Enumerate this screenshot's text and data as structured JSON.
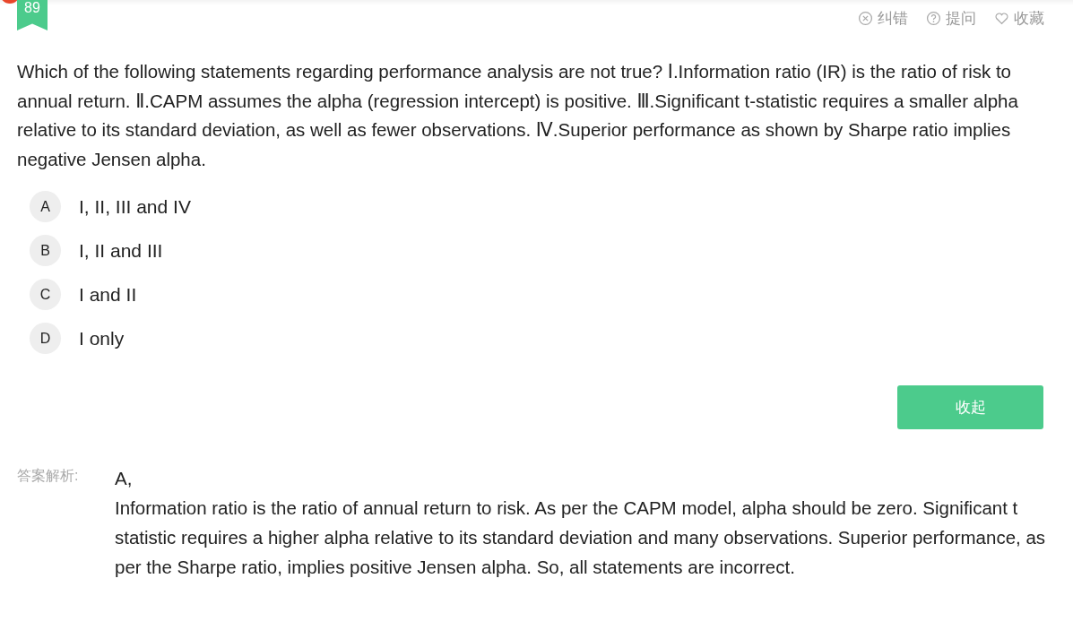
{
  "question": {
    "number": "89",
    "actions": [
      {
        "kind": "report",
        "label": "纠错"
      },
      {
        "kind": "ask",
        "label": "提问"
      },
      {
        "kind": "favorite",
        "label": "收藏"
      }
    ],
    "text": "Which of the following statements regarding performance analysis are not true? Ⅰ.Information ratio (IR) is the ratio of risk to annual return.  Ⅱ.CAPM assumes the alpha (regression intercept) is positive. Ⅲ.Significant t-statistic requires a smaller alpha relative to its standard deviation, as well as fewer observations.  Ⅳ.Superior performance as shown by Sharpe ratio implies negative Jensen alpha.",
    "options": [
      {
        "letter": "A",
        "text": "I, II, III and IV"
      },
      {
        "letter": "B",
        "text": "I, II and III"
      },
      {
        "letter": "C",
        "text": "I and II"
      },
      {
        "letter": "D",
        "text": "I only"
      }
    ],
    "collapse_button": "收起"
  },
  "analysis": {
    "label": "答案解析:",
    "answer": "A,",
    "explanation": "Information ratio is the ratio of annual return to risk. As per the CAPM model, alpha should be zero. Significant t statistic requires a higher alpha relative to its standard deviation and many observations. Superior performance, as per the Sharpe ratio, implies positive Jensen alpha. So, all statements are incorrect."
  }
}
